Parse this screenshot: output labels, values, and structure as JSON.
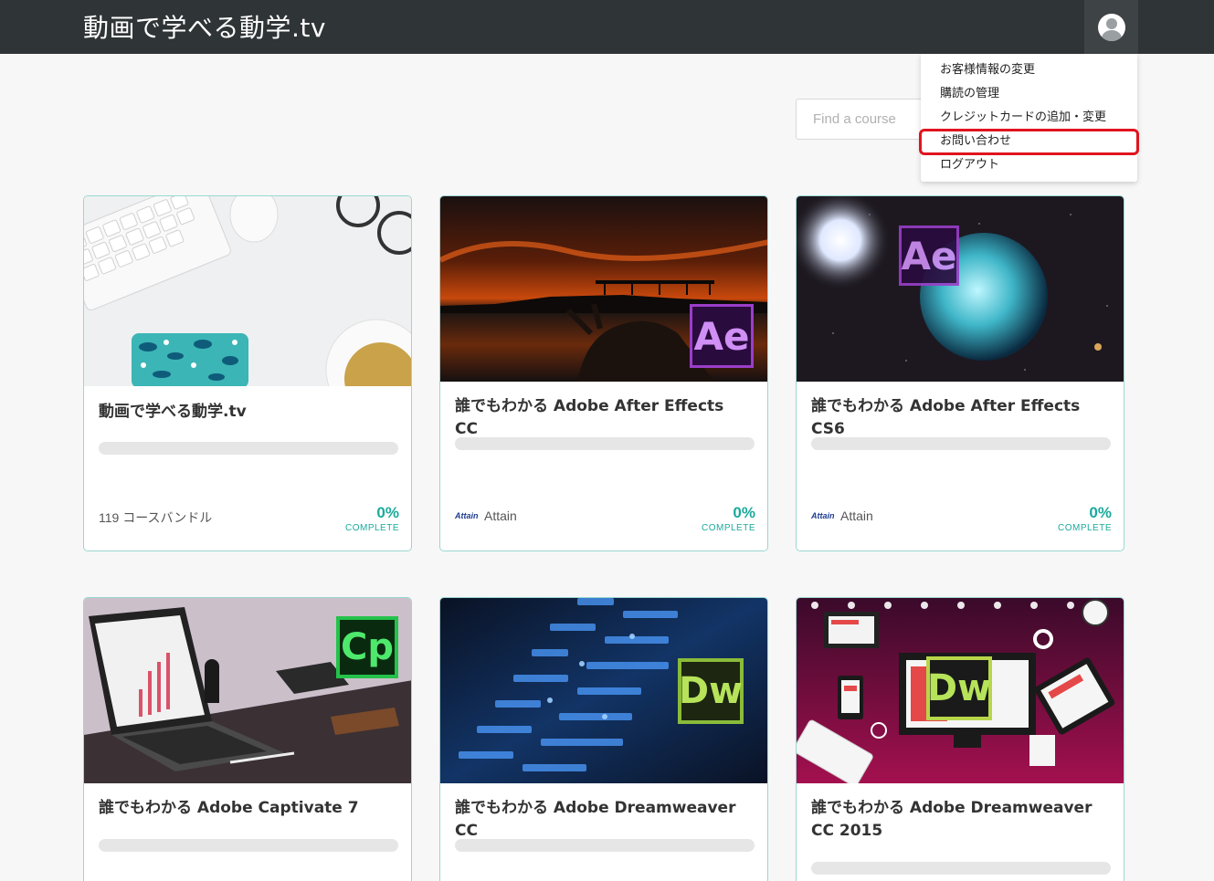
{
  "brand": "動画で学べる動学.tv",
  "search": {
    "placeholder": "Find a course"
  },
  "menu": {
    "items": [
      "お客様情報の変更",
      "購読の管理",
      "クレジットカードの追加・変更",
      "お問い合わせ",
      "ログアウト"
    ],
    "highlighted_index": 3
  },
  "courses": [
    {
      "title": "動画で学べる動学.tv",
      "author": "119 コースバンドル",
      "percent": "0%",
      "complete": "COMPLETE",
      "progress": 0
    },
    {
      "title": "誰でもわかる Adobe After Effects CC",
      "author": "Attain",
      "author_logo": "Attain",
      "logo": "Ae",
      "percent": "0%",
      "complete": "COMPLETE",
      "progress": 0
    },
    {
      "title": "誰でもわかる Adobe After Effects CS6",
      "author": "Attain",
      "author_logo": "Attain",
      "logo": "Ae",
      "percent": "0%",
      "complete": "COMPLETE",
      "progress": 0
    },
    {
      "title": "誰でもわかる Adobe Captivate 7",
      "logo": "Cp",
      "progress": 0
    },
    {
      "title": "誰でもわかる Adobe Dreamweaver CC",
      "logo": "Dw",
      "progress": 0
    },
    {
      "title": "誰でもわかる Adobe Dreamweaver CC 2015",
      "logo": "Dw",
      "progress": 0
    }
  ],
  "colors": {
    "navbar": "#2f3436",
    "accent": "#1aaa9c",
    "highlight": "#e0141e",
    "card_border": "#9ad8d0"
  }
}
